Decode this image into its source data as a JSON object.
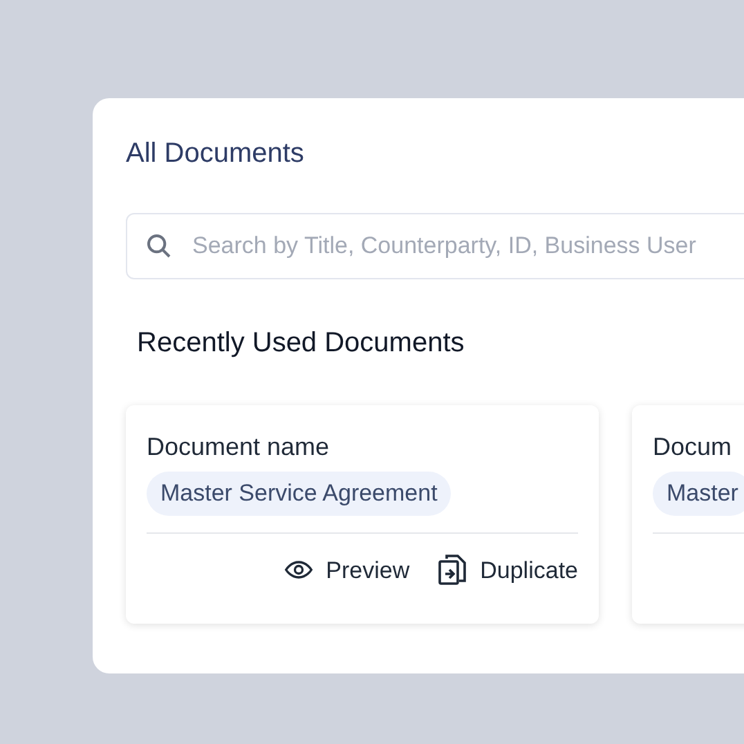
{
  "title": "All Documents",
  "search": {
    "placeholder": "Search by Title, Counterparty, ID, Business User"
  },
  "section_title": "Recently Used Documents",
  "cards": [
    {
      "title": "Document name",
      "tag": "Master Service Agreement",
      "actions": [
        {
          "kind": "preview",
          "label": "Preview"
        },
        {
          "kind": "duplicate",
          "label": "Duplicate"
        }
      ]
    },
    {
      "title": "Docum",
      "tag": "Master"
    }
  ]
}
